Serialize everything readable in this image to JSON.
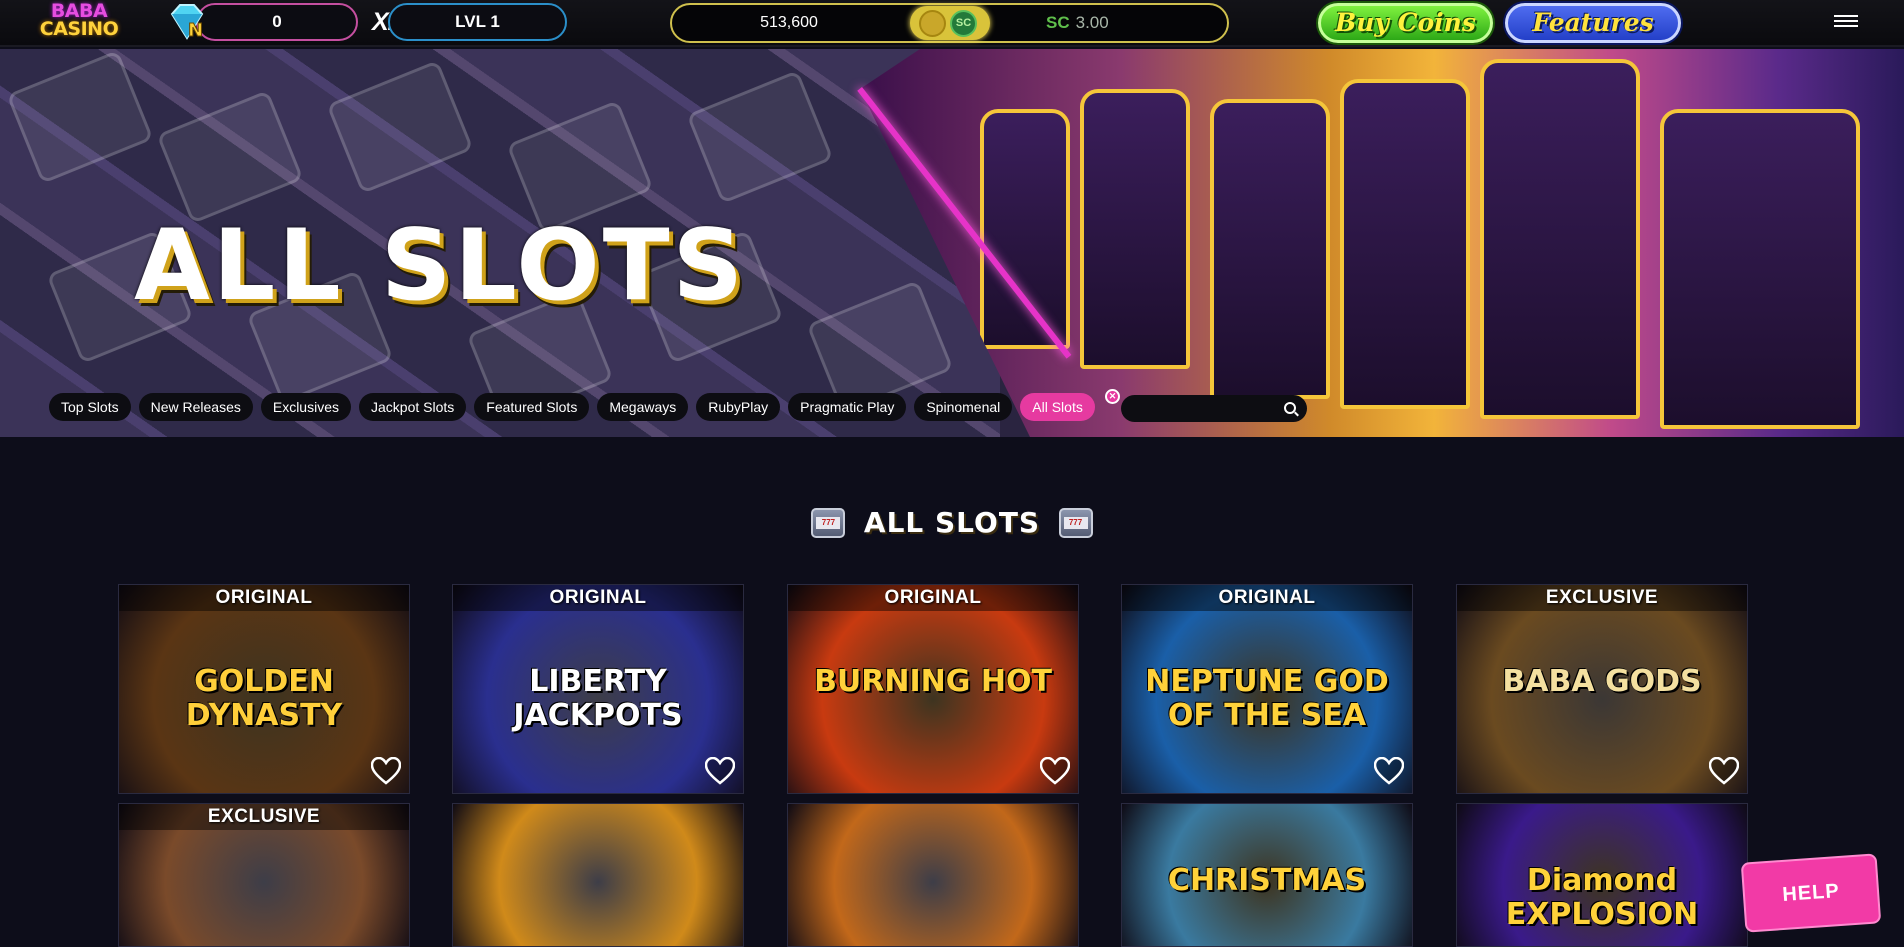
{
  "header": {
    "logo_line1": "BABA",
    "logo_line2": "CASINO",
    "gem_letter": "N",
    "gem_count": "0",
    "xp_label": "XP",
    "level": "LVL 1",
    "gold_coins": "513,600",
    "sc_label": "SC",
    "sc_amount": "3.00",
    "buy_coins_label": "Buy Coins",
    "features_label": "Features"
  },
  "hero": {
    "title": "ALL SLOTS",
    "tabs": [
      "Top Slots",
      "New Releases",
      "Exclusives",
      "Jackpot Slots",
      "Featured Slots",
      "Megaways",
      "RubyPlay",
      "Pragmatic Play",
      "Spinomenal",
      "All Slots"
    ],
    "active_tab": "All Slots",
    "search_placeholder": ""
  },
  "section": {
    "title": "ALL SLOTS"
  },
  "games": [
    {
      "badge": "ORIGINAL",
      "name": "GOLDEN DYNASTY",
      "bg": "#5a3514",
      "accent": "#ffcf3a"
    },
    {
      "badge": "ORIGINAL",
      "name": "LIBERTY JACKPOTS",
      "bg": "#2a2f8f",
      "accent": "#ffffff"
    },
    {
      "badge": "ORIGINAL",
      "name": "BURNING HOT",
      "bg": "#c83a10",
      "accent": "#ffd23a"
    },
    {
      "badge": "ORIGINAL",
      "name": "NEPTUNE GOD OF THE SEA",
      "bg": "#1a5fa8",
      "accent": "#ffd23a"
    },
    {
      "badge": "EXCLUSIVE",
      "name": "BABA GODS",
      "bg": "#6a4a20",
      "accent": "#f4e0a0"
    },
    {
      "badge": "EXCLUSIVE",
      "name": "",
      "bg": "#7a4a2a",
      "accent": "#ffffff"
    },
    {
      "badge": "",
      "name": "",
      "bg": "#d08a1a",
      "accent": "#ffffff"
    },
    {
      "badge": "",
      "name": "",
      "bg": "#c2681a",
      "accent": "#ffffff"
    },
    {
      "badge": "",
      "name": "CHRISTMAS",
      "bg": "#3a7aa0",
      "accent": "#ffd23a"
    },
    {
      "badge": "",
      "name": "Diamond EXPLOSION",
      "bg": "#3a1a8a",
      "accent": "#ffd23a"
    }
  ],
  "help_label": "HELP"
}
